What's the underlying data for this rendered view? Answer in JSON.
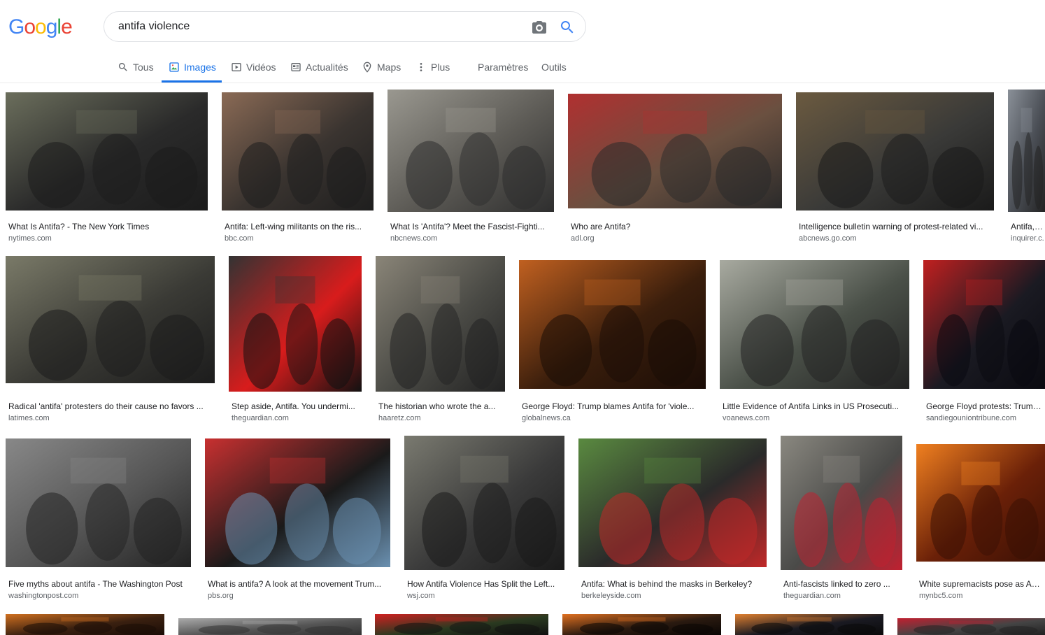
{
  "logo_text": [
    "G",
    "o",
    "o",
    "g",
    "l",
    "e"
  ],
  "logo_colors": [
    "#4285F4",
    "#EA4335",
    "#FBBC05",
    "#4285F4",
    "#34A853",
    "#EA4335"
  ],
  "search": {
    "value": "antifa violence"
  },
  "tabs": [
    {
      "label": "Tous",
      "icon": "search-icon"
    },
    {
      "label": "Images",
      "icon": "image-icon",
      "active": true
    },
    {
      "label": "Vidéos",
      "icon": "play-icon"
    },
    {
      "label": "Actualités",
      "icon": "news-icon"
    },
    {
      "label": "Maps",
      "icon": "map-pin-icon"
    },
    {
      "label": "Plus",
      "icon": "more-vert-icon"
    },
    {
      "label": "Paramètres"
    },
    {
      "label": "Outils"
    }
  ],
  "results": [
    {
      "title": "What Is Antifa? - The New York Times",
      "source": "nytimes.com",
      "palette": [
        "#2a2a2a",
        "#6b6e5c",
        "#1b1b1b"
      ]
    },
    {
      "title": "Antifa: Left-wing militants on the ris...",
      "source": "bbc.com",
      "palette": [
        "#3a3430",
        "#8a6a55",
        "#1e1e1e"
      ]
    },
    {
      "title": "What Is 'Antifa'? Meet the Fascist-Fighti...",
      "source": "nbcnews.com",
      "palette": [
        "#5c5a55",
        "#9a9890",
        "#2e2e2e"
      ]
    },
    {
      "title": "Who are Antifa?",
      "source": "adl.org",
      "palette": [
        "#6a5040",
        "#b03030",
        "#2a2a2a"
      ]
    },
    {
      "title": "Intelligence bulletin warning of protest-related vi...",
      "source": "abcnews.go.com",
      "palette": [
        "#3a3a38",
        "#6b5a40",
        "#1a1a1a"
      ]
    },
    {
      "title": "Antifa, bl...",
      "source": "inquirer.c...",
      "palette": [
        "#4a4e55",
        "#8a9098",
        "#222"
      ]
    },
    {
      "title": "Radical 'antifa' protesters do their cause no favors ...",
      "source": "latimes.com",
      "palette": [
        "#3a3a35",
        "#7a7a68",
        "#1c1c1c"
      ]
    },
    {
      "title": "Step aside, Antifa. You undermi...",
      "source": "theguardian.com",
      "palette": [
        "#d81c1c",
        "#333",
        "#111"
      ]
    },
    {
      "title": "The historian who wrote the a...",
      "source": "haaretz.com",
      "palette": [
        "#4a4a45",
        "#8a8578",
        "#222"
      ]
    },
    {
      "title": "George Floyd: Trump blames Antifa for 'viole...",
      "source": "globalnews.ca",
      "palette": [
        "#3a1e0c",
        "#c06020",
        "#1a0c06"
      ]
    },
    {
      "title": "Little Evidence of Antifa Links in US Prosecuti...",
      "source": "voanews.com",
      "palette": [
        "#4a5048",
        "#a8aaa0",
        "#222"
      ]
    },
    {
      "title": "George Floyd protests: Trump b...",
      "source": "sandiegouniontribune.com",
      "palette": [
        "#1a1a22",
        "#c02020",
        "#0a0a10"
      ]
    },
    {
      "title": "Five myths about antifa - The Washington Post",
      "source": "washingtonpost.com",
      "palette": [
        "#555",
        "#888",
        "#222"
      ]
    },
    {
      "title": "What is antifa? A look at the movement Trum...",
      "source": "pbs.org",
      "palette": [
        "#1a1a1a",
        "#c83030",
        "#6a90b0"
      ]
    },
    {
      "title": "How Antifa Violence Has Split the Left...",
      "source": "wsj.com",
      "palette": [
        "#3a3a3a",
        "#7a7a70",
        "#1a1a1a"
      ]
    },
    {
      "title": "Antifa: What is behind the masks in Berkeley?",
      "source": "berkeleyside.com",
      "palette": [
        "#2a2a2a",
        "#5a8a40",
        "#c02828"
      ]
    },
    {
      "title": "Anti-fascists linked to zero ...",
      "source": "theguardian.com",
      "palette": [
        "#4a4a48",
        "#8a8880",
        "#c02030"
      ]
    },
    {
      "title": "White supremacists pose as Anti...",
      "source": "mynbc5.com",
      "palette": [
        "#6a2008",
        "#f08020",
        "#3a1004"
      ]
    },
    {
      "title": "",
      "source": "",
      "palette": [
        "#3a2010",
        "#d07020",
        "#1a0c06"
      ]
    },
    {
      "title": "",
      "source": "",
      "palette": [
        "#555",
        "#aaa",
        "#333"
      ]
    },
    {
      "title": "",
      "source": "",
      "palette": [
        "#2a3a20",
        "#d02020",
        "#111"
      ]
    },
    {
      "title": "",
      "source": "",
      "palette": [
        "#2a1a10",
        "#e07020",
        "#0a0604"
      ]
    },
    {
      "title": "",
      "source": "",
      "palette": [
        "#1a1a22",
        "#e08030",
        "#0a0a0a"
      ]
    },
    {
      "title": "",
      "source": "",
      "palette": [
        "#444",
        "#c02030",
        "#222"
      ]
    }
  ]
}
